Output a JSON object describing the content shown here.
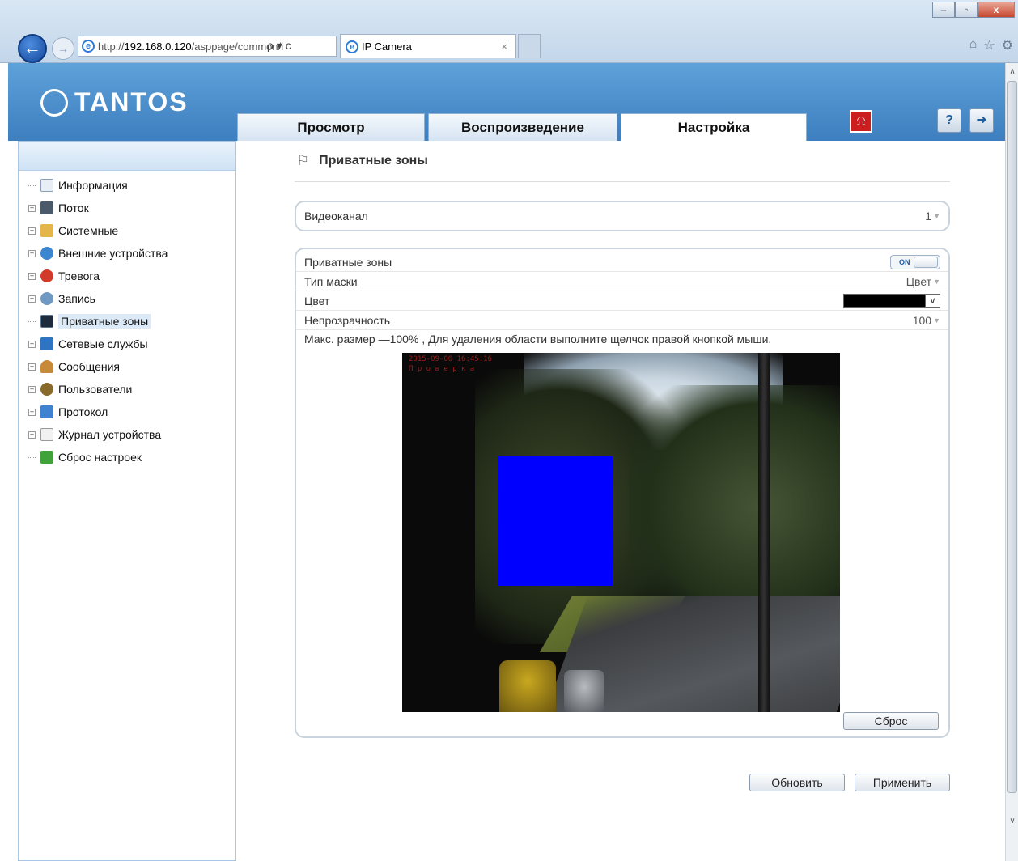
{
  "browser": {
    "window_buttons": [
      "–",
      "▫",
      "x"
    ],
    "address_url_prefix": "http://",
    "address_url_host": "192.168.0.120",
    "address_url_rest": "/asppage/common/i",
    "address_tools": "ρ ▾ c",
    "tab_title": "IP Camera",
    "tab_close": "×"
  },
  "header": {
    "logo_text": "TANTOS",
    "tabs": [
      {
        "label": "Просмотр"
      },
      {
        "label": "Воспроизведение"
      },
      {
        "label": "Настройка"
      }
    ],
    "active_tab": "Настройка"
  },
  "sidebar": {
    "items": [
      {
        "label": "Информация",
        "icon": "info-icon",
        "expandable": false
      },
      {
        "label": "Поток",
        "icon": "stream-icon",
        "expandable": true
      },
      {
        "label": "Системные",
        "icon": "system-icon",
        "expandable": true
      },
      {
        "label": "Внешние устройства",
        "icon": "external-devices-icon",
        "expandable": true
      },
      {
        "label": "Тревога",
        "icon": "alarm-icon",
        "expandable": true
      },
      {
        "label": "Запись",
        "icon": "record-icon",
        "expandable": true
      },
      {
        "label": "Приватные зоны",
        "icon": "privacy-icon",
        "expandable": false,
        "selected": true
      },
      {
        "label": "Сетевые службы",
        "icon": "network-icon",
        "expandable": true
      },
      {
        "label": "Сообщения",
        "icon": "messages-icon",
        "expandable": true
      },
      {
        "label": "Пользователи",
        "icon": "users-icon",
        "expandable": true
      },
      {
        "label": "Протокол",
        "icon": "protocol-icon",
        "expandable": true
      },
      {
        "label": "Журнал устройства",
        "icon": "log-icon",
        "expandable": true
      },
      {
        "label": "Сброс настроек",
        "icon": "reset-icon",
        "expandable": false
      }
    ]
  },
  "main": {
    "page_title": "Приватные зоны",
    "video_channel": {
      "label": "Видеоканал",
      "value": "1"
    },
    "settings": {
      "privacy_label": "Приватные зоны",
      "privacy_toggle": "ON",
      "mask_type_label": "Тип маски",
      "mask_type_value": "Цвет",
      "color_label": "Цвет",
      "color_value": "#000000",
      "opacity_label": "Непрозрачность",
      "opacity_value": "100",
      "hint": "Макс. размер —100% , Для удаления области выполните щелчок правой кнопкой мыши."
    },
    "video": {
      "osd_timestamp": "2015-09-06 16:45:16",
      "osd_label": "П р о в е р к а",
      "zone_color": "#0000ff"
    },
    "buttons": {
      "reset": "Сброс",
      "refresh": "Обновить",
      "apply": "Применить"
    }
  }
}
